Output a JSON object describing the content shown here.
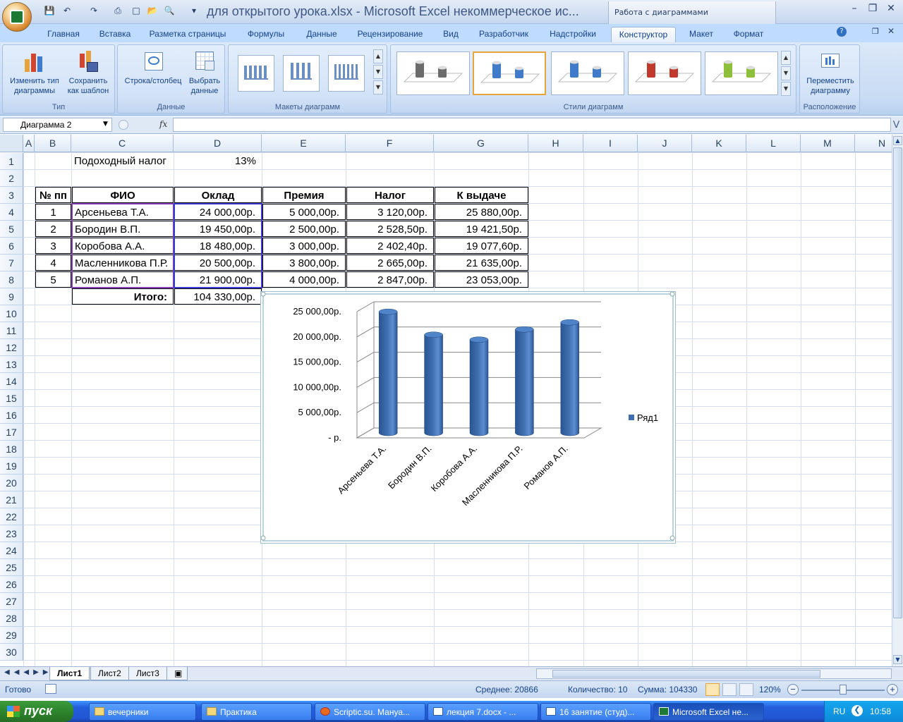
{
  "window": {
    "title": "для открытого урока.xlsx - Microsoft Excel некоммерческое ис...",
    "context_group": "Работа с диаграммами"
  },
  "tabs": [
    "Главная",
    "Вставка",
    "Разметка страницы",
    "Формулы",
    "Данные",
    "Рецензирование",
    "Вид",
    "Разработчик",
    "Надстройки",
    "Конструктор",
    "Макет",
    "Формат"
  ],
  "ribbon": {
    "type_group": {
      "label": "Тип",
      "change_type": [
        "Изменить тип",
        "диаграммы"
      ],
      "save_template": [
        "Сохранить",
        "как шаблон"
      ]
    },
    "data_group": {
      "label": "Данные",
      "row_col": "Строка/столбец",
      "select_data": [
        "Выбрать",
        "данные"
      ]
    },
    "layouts_group": {
      "label": "Макеты диаграмм"
    },
    "styles_group": {
      "label": "Стили диаграмм",
      "colors": [
        "#6b6b6b",
        "#3f7bc8",
        "#3f7bc8",
        "#c0392b",
        "#8fbf3a"
      ]
    },
    "location_group": {
      "label": "Расположение",
      "move": [
        "Переместить",
        "диаграмму"
      ]
    }
  },
  "formula_bar": {
    "name_box": "Диаграмма 2",
    "fx": "fx",
    "value": ""
  },
  "columns": [
    "A",
    "B",
    "C",
    "D",
    "E",
    "F",
    "G",
    "H",
    "I",
    "J",
    "K",
    "L",
    "M",
    "N"
  ],
  "rows": [
    "1",
    "2",
    "3",
    "4",
    "5",
    "6",
    "7",
    "8",
    "9",
    "10",
    "11",
    "12",
    "13",
    "14",
    "15",
    "16",
    "17",
    "18",
    "19",
    "20",
    "21",
    "22",
    "23",
    "24",
    "25",
    "26",
    "27",
    "28",
    "29",
    "30"
  ],
  "sheet": {
    "tax_label": "Подоходный налог",
    "tax_value": "13%",
    "headers": [
      "№ пп",
      "ФИО",
      "Оклад",
      "Премия",
      "Налог",
      "К выдаче"
    ],
    "table": [
      [
        "1",
        "Арсеньева Т.А.",
        "24 000,00р.",
        "5 000,00р.",
        "3 120,00р.",
        "25 880,00р."
      ],
      [
        "2",
        "Бородин В.П.",
        "19 450,00р.",
        "2 500,00р.",
        "2 528,50р.",
        "19 421,50р."
      ],
      [
        "3",
        "Коробова А.А.",
        "18 480,00р.",
        "3 000,00р.",
        "2 402,40р.",
        "19 077,60р."
      ],
      [
        "4",
        "Масленникова П.Р.",
        "20 500,00р.",
        "3 800,00р.",
        "2 665,00р.",
        "21 635,00р."
      ],
      [
        "5",
        "Романов А.П.",
        "21 900,00р.",
        "4 000,00р.",
        "2 847,00р.",
        "23 053,00р."
      ]
    ],
    "total_label": "Итого:",
    "total_value": "104 330,00р."
  },
  "chart_data": {
    "type": "bar",
    "categories": [
      "Арсеньева Т.А.",
      "Бородин В.П.",
      "Коробова А.А.",
      "Масленникова П.Р.",
      "Романов А.П."
    ],
    "series": [
      {
        "name": "Ряд1",
        "values": [
          24000,
          19450,
          18480,
          20500,
          21900
        ]
      }
    ],
    "ylim": [
      0,
      25000
    ],
    "yticks": [
      "-  р.",
      "5 000,00р.",
      "10 000,00р.",
      "15 000,00р.",
      "20 000,00р.",
      "25 000,00р."
    ],
    "legend": "right",
    "grid": true,
    "color": "#3f6fb0"
  },
  "sheet_tabs": [
    "Лист1",
    "Лист2",
    "Лист3"
  ],
  "status": {
    "ready": "Готово",
    "average": "Среднее: 20866",
    "count": "Количество: 10",
    "sum": "Сумма: 104330",
    "zoom": "120%"
  },
  "taskbar": {
    "start": "пуск",
    "items": [
      "вечерники",
      "Практика",
      "Scriptic.su. Мануа...",
      "лекция 7.docx - ...",
      "16 занятие (студ)...",
      "Microsoft Excel не..."
    ],
    "lang": "RU",
    "clock": "10:58"
  }
}
